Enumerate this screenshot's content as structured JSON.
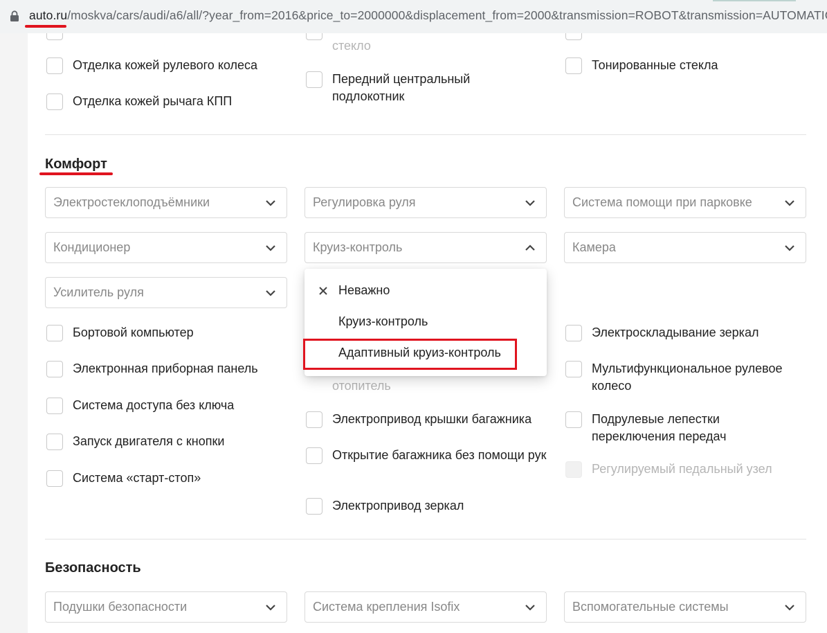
{
  "browser": {
    "url_domain": "auto.ru",
    "url_rest": "/moskva/cars/audi/a6/all/?year_from=2016&price_to=2000000&displacement_from=2000&transmission=ROBOT&transmission=AUTOMATIC"
  },
  "interior": {
    "partial_col1": "",
    "partial_col2": "стекло",
    "items": [
      "Отделка кожей рулевого колеса",
      "Отделка кожей рычага КПП",
      "Передний центральный подлокотник",
      "Тонированные стекла"
    ]
  },
  "comfort": {
    "title": "Комфорт",
    "selects": [
      "Электростеклоподъёмники",
      "Регулировка руля",
      "Система помощи при парковке",
      "Кондиционер",
      "Круиз-контроль",
      "Камера",
      "Усилитель руля"
    ],
    "dropdown": {
      "options": [
        "Неважно",
        "Круиз-контроль",
        "Адаптивный круиз-контроль"
      ]
    },
    "col1": [
      "Бортовой компьютер",
      "Электронная приборная панель",
      "Система доступа без ключа",
      "Запуск двигателя с кнопки",
      "Система «старт-стоп»"
    ],
    "col2_partial": "отопитель",
    "col2": [
      "Электропривод крышки багажника",
      "Открытие багажника без помощи рук",
      "Электропривод зеркал"
    ],
    "col3": [
      "Электроскладывание зеркал",
      "Мультифункциональное рулевое колесо",
      "Подрулевые лепестки переключения передач",
      "Регулируемый педальный узел"
    ]
  },
  "safety": {
    "title": "Безопасность",
    "selects": [
      "Подушки безопасности",
      "Система крепления Isofix",
      "Вспомогательные системы"
    ]
  },
  "colors": {
    "accent": "#e0141f",
    "muted": "#b5b5b5"
  }
}
